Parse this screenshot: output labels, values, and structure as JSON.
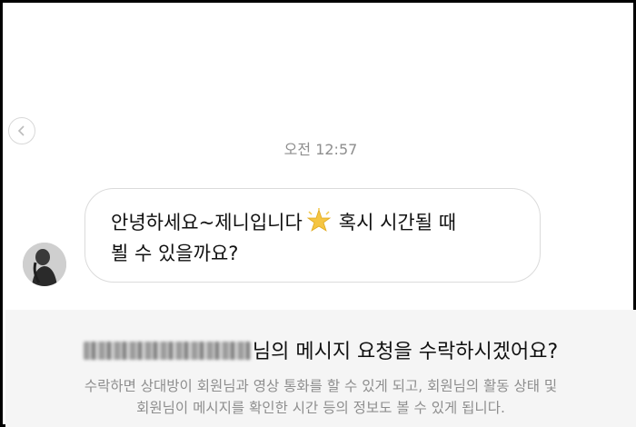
{
  "conversation": {
    "timestamp": "오전 12:57",
    "back_icon": "chevron-left-icon",
    "avatar_icon": "profile-avatar",
    "message": {
      "line1_before": "안녕하세요~제니입니다",
      "emoji": "sparkle-star-icon",
      "line1_after": "혹시 시간될 때",
      "line2": "뵐 수 있을까요?"
    }
  },
  "request": {
    "title_suffix": "님의 메시지 요청을 수락하시겠어요?",
    "description": "수락하면 상대방이 회원님과 영상 통화를 할 수 있게 되고, 회원님의 활동 상태 및\n회원님이 메시지를 확인한 시간 등의 정보도 볼 수 있게 됩니다."
  },
  "colors": {
    "frame_border": "#000000",
    "bubble_border": "#dbdbdb",
    "panel_background": "#f5f5f5",
    "muted_text": "#8e8e8e",
    "primary_text": "#111111"
  }
}
